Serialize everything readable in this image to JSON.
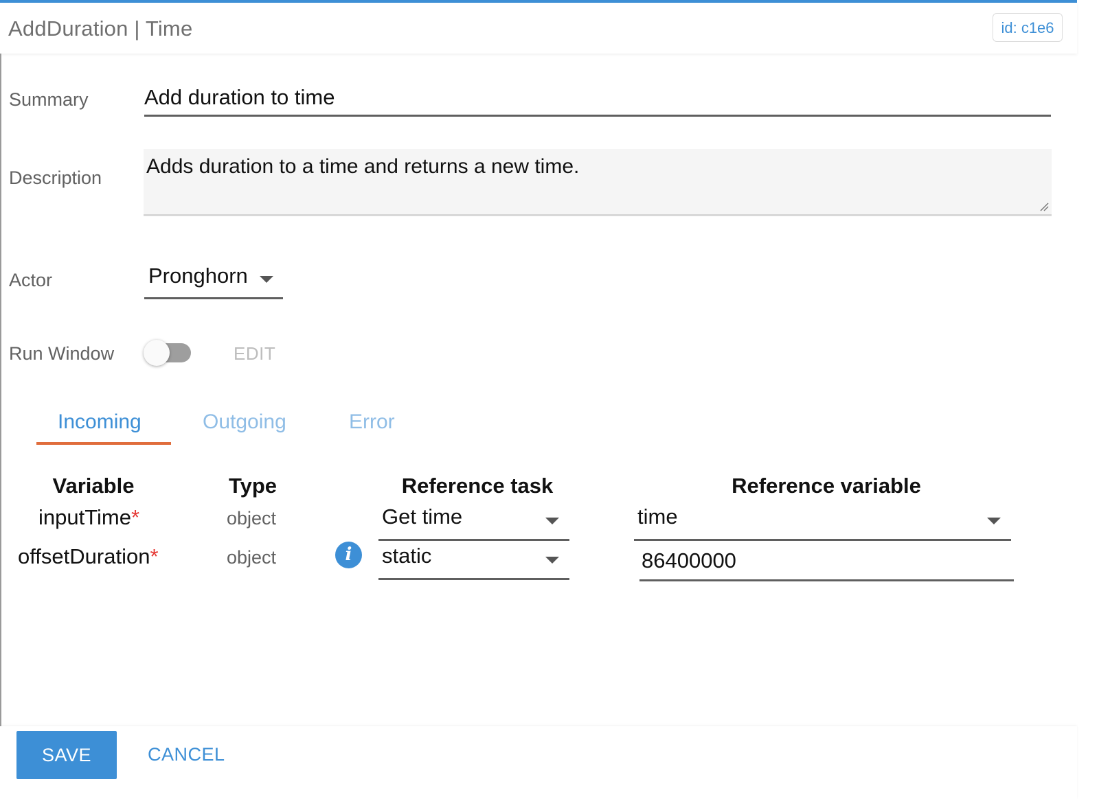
{
  "header": {
    "title": "AddDuration | Time",
    "id_badge": "id: c1e6"
  },
  "form": {
    "summary": {
      "label": "Summary",
      "value": "Add duration to time"
    },
    "description": {
      "label": "Description",
      "value": "Adds duration to a time and returns a new time."
    },
    "actor": {
      "label": "Actor",
      "value": "Pronghorn"
    },
    "run_window": {
      "label": "Run Window",
      "enabled": false,
      "edit_label": "EDIT"
    }
  },
  "tabs": [
    {
      "label": "Incoming",
      "active": true
    },
    {
      "label": "Outgoing",
      "active": false
    },
    {
      "label": "Error",
      "active": false
    }
  ],
  "table": {
    "headers": {
      "variable": "Variable",
      "type": "Type",
      "ref_task": "Reference task",
      "ref_var": "Reference variable"
    },
    "rows": [
      {
        "variable": "inputTime",
        "required_mark": "*",
        "type": "object",
        "ref_task": "Get time",
        "ref_var": "time"
      },
      {
        "variable": "offsetDuration",
        "required_mark": "*",
        "type": "object",
        "ref_task": "static",
        "ref_var": "86400000",
        "info_icon": "info-icon"
      }
    ]
  },
  "footer": {
    "save_label": "SAVE",
    "cancel_label": "CANCEL"
  },
  "colors": {
    "accent": "#3d8fd6",
    "tab_indicator": "#e06d3c",
    "required": "#e53935"
  }
}
